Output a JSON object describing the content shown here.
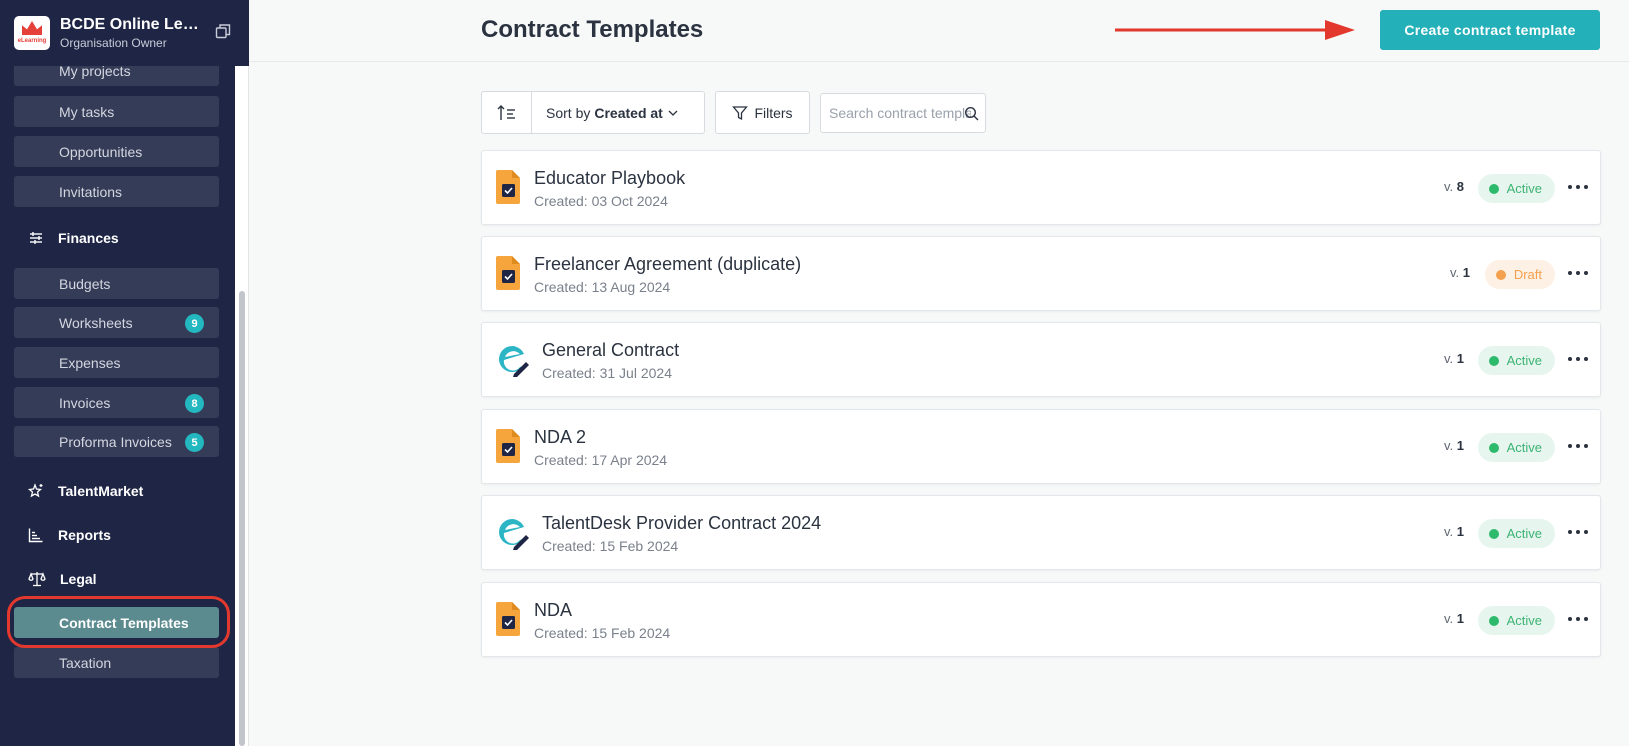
{
  "org": {
    "name": "BCDE Online Lear...",
    "role": "Organisation Owner",
    "logo_text": "eLearning"
  },
  "sidebar": {
    "items_top": [
      {
        "label": "My projects"
      },
      {
        "label": "My tasks"
      },
      {
        "label": "Opportunities"
      },
      {
        "label": "Invitations"
      }
    ],
    "finances_label": "Finances",
    "finance_items": [
      {
        "label": "Budgets",
        "badge": ""
      },
      {
        "label": "Worksheets",
        "badge": "9"
      },
      {
        "label": "Expenses",
        "badge": ""
      },
      {
        "label": "Invoices",
        "badge": "8"
      },
      {
        "label": "Proforma Invoices",
        "badge": "5"
      }
    ],
    "talentmarket_label": "TalentMarket",
    "reports_label": "Reports",
    "legal_label": "Legal",
    "legal_items": [
      {
        "label": "Contract Templates",
        "active": true
      },
      {
        "label": "Taxation",
        "active": false
      }
    ]
  },
  "header": {
    "title": "Contract Templates",
    "create_button": "Create contract template"
  },
  "toolbar": {
    "sort_prefix": "Sort by",
    "sort_field": "Created at",
    "filters_label": "Filters",
    "search_placeholder": "Search contract templates"
  },
  "templates": [
    {
      "title": "Educator Playbook",
      "created": "Created: 03 Oct 2024",
      "version_prefix": "v.",
      "version": "8",
      "status": "Active",
      "icon": "document-check-icon"
    },
    {
      "title": "Freelancer Agreement (duplicate)",
      "created": "Created: 13 Aug 2024",
      "version_prefix": "v.",
      "version": "1",
      "status": "Draft",
      "icon": "document-check-icon"
    },
    {
      "title": "General Contract",
      "created": "Created: 31 Jul 2024",
      "version_prefix": "v.",
      "version": "1",
      "status": "Active",
      "icon": "esign-icon"
    },
    {
      "title": "NDA 2",
      "created": "Created: 17 Apr 2024",
      "version_prefix": "v.",
      "version": "1",
      "status": "Active",
      "icon": "document-check-icon"
    },
    {
      "title": "TalentDesk Provider Contract 2024",
      "created": "Created: 15 Feb 2024",
      "version_prefix": "v.",
      "version": "1",
      "status": "Active",
      "icon": "esign-icon"
    },
    {
      "title": "NDA",
      "created": "Created: 15 Feb 2024",
      "version_prefix": "v.",
      "version": "1",
      "status": "Active",
      "icon": "document-check-icon"
    }
  ],
  "colors": {
    "sidebar_bg": "#1f2645",
    "nav_item_bg": "#353c58",
    "nav_active_bg": "#5b8a8f",
    "accent": "#23b0b9",
    "annotation_red": "#e2382d",
    "status_active": "#2eba6d",
    "status_draft": "#f5a04d"
  }
}
